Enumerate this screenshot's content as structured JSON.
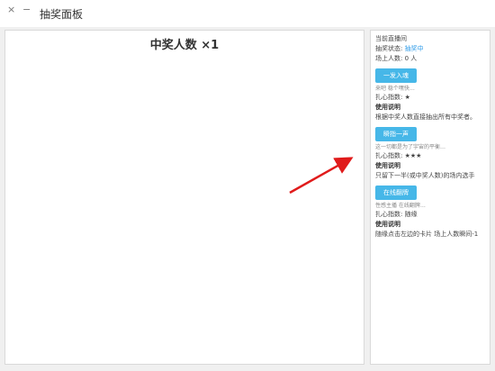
{
  "window": {
    "close_glyph": "×",
    "minimize_glyph": "−",
    "title": "抽奖面板"
  },
  "main": {
    "winners_label": "中奖人数 ×1"
  },
  "side": {
    "current_live": "当前直播间",
    "status_label": "抽奖状态:",
    "status_value": "抽奖中",
    "audience": "场上人数: 0 人",
    "modes": [
      {
        "button": "一发入魂",
        "desc": "来吧 稳个嘿快…",
        "stars": "扎心指数: ★",
        "usage_title": "使用说明",
        "usage": "根据中奖人数直接抽出所有中奖者。"
      },
      {
        "button": "瞬指一声",
        "desc": "这一切都是为了宇宙的平衡…",
        "stars": "扎心指数: ★★★",
        "usage_title": "使用说明",
        "usage": "只留下一半(或中奖人数)的场内选手"
      },
      {
        "button": "在线翻牌",
        "desc": "性感主播 在线翻牌…",
        "stars": "扎心指数: 随缘",
        "usage_title": "使用说明",
        "usage": "随缘点击左边的卡片 场上人数瞬间-1"
      }
    ]
  },
  "colors": {
    "button_bg": "#46b7e8",
    "status_accent": "#2e9be8",
    "arrow": "#e01b1b"
  }
}
